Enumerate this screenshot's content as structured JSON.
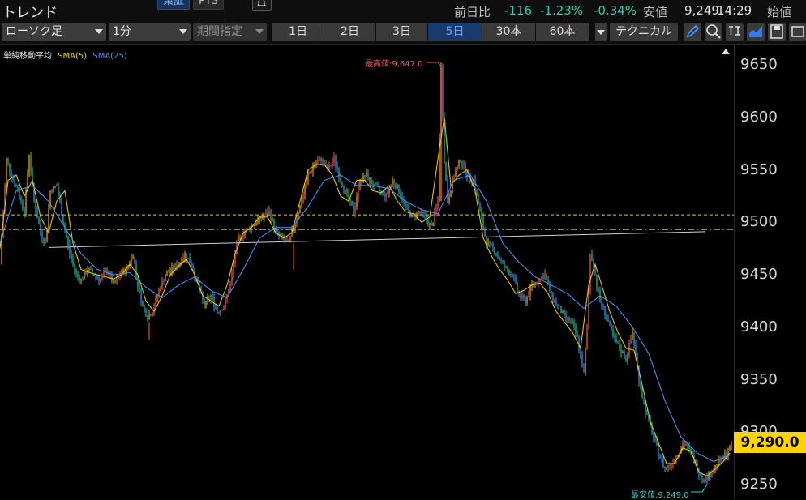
{
  "header": {
    "title": "トレンド",
    "exchange_tabs": [
      "東証",
      "PTS"
    ],
    "prev_day_label": "前日比",
    "change": "-116",
    "change_pct": "-1.23%",
    "change_pct2": "-0.34%",
    "low_label": "安値",
    "low_value": "9,249",
    "time": "14:29",
    "open_label": "始値"
  },
  "toolbar": {
    "chart_type": "ローソク足",
    "interval": "1分",
    "period_placeholder": "期間指定",
    "period_tabs": [
      "1日",
      "2日",
      "3日",
      "5日",
      "30本",
      "60本"
    ],
    "active_period": "5日",
    "technical_label": "テクニカル",
    "icons": [
      "draw-pencil-icon",
      "zoom-icon",
      "output-icon",
      "area-chart-icon",
      "save-icon",
      "window-icon"
    ]
  },
  "legend": {
    "name": "単純移動平均",
    "sma5": "SMA(5)",
    "sma25": "SMA(25)",
    "sma5_color": "#f0d000",
    "sma25_color": "#4f8fff"
  },
  "chart_data": {
    "type": "line",
    "title": "",
    "ylim": [
      9230,
      9680
    ],
    "yticks": [
      9250,
      9300,
      9350,
      9400,
      9450,
      9500,
      9550,
      9600,
      9650
    ],
    "current_price": "9,290.0",
    "high_label": "最高値:9,647.0",
    "low_label": "最安値:9,249.0",
    "reference_lines": [
      {
        "name": "yellow-dashed",
        "value": 9507,
        "color": "#e8d000"
      },
      {
        "name": "cyan-dashdot",
        "value": 9493,
        "color": "#20c8c8"
      }
    ],
    "trend_line": {
      "x": [
        60,
        870
      ],
      "y": [
        9476,
        9491
      ],
      "color": "#d0d0d0"
    },
    "series": [
      {
        "price_path": true,
        "x": [
          0,
          8,
          14,
          22,
          30,
          36,
          42,
          50,
          56,
          62,
          70,
          78,
          86,
          94,
          100,
          108,
          116,
          124,
          132,
          140,
          148,
          156,
          164,
          170,
          176,
          182,
          188,
          196,
          204,
          212,
          220,
          228,
          236,
          244,
          252,
          260,
          268,
          276,
          284,
          292,
          300,
          308,
          316,
          324,
          332,
          340,
          348,
          356,
          364,
          372,
          380,
          388,
          396,
          404,
          412,
          420,
          428,
          436,
          444,
          452,
          460,
          468,
          476,
          484,
          492,
          500,
          508,
          516,
          524,
          532,
          540,
          544,
          548,
          552,
          560,
          568,
          576,
          584,
          592,
          600,
          608,
          616,
          624,
          632,
          640,
          648,
          656,
          664,
          672,
          680,
          688,
          696,
          704,
          712,
          720,
          724,
          728,
          732,
          736,
          740,
          748,
          756,
          764,
          772,
          780,
          788,
          796,
          804,
          812,
          820,
          828,
          836,
          844,
          852,
          860,
          868,
          876,
          884,
          892,
          900
        ],
        "y": [
          9460,
          9560,
          9545,
          9530,
          9510,
          9565,
          9520,
          9490,
          9480,
          9530,
          9535,
          9500,
          9470,
          9450,
          9445,
          9455,
          9450,
          9445,
          9455,
          9440,
          9450,
          9455,
          9470,
          9440,
          9420,
          9410,
          9415,
          9435,
          9450,
          9455,
          9460,
          9470,
          9460,
          9440,
          9420,
          9430,
          9415,
          9420,
          9440,
          9480,
          9490,
          9495,
          9500,
          9505,
          9510,
          9490,
          9485,
          9480,
          9500,
          9520,
          9545,
          9555,
          9560,
          9550,
          9560,
          9540,
          9525,
          9510,
          9540,
          9545,
          9535,
          9530,
          9525,
          9540,
          9530,
          9515,
          9505,
          9510,
          9505,
          9495,
          9520,
          9647,
          9560,
          9520,
          9545,
          9560,
          9545,
          9540,
          9510,
          9480,
          9475,
          9465,
          9455,
          9450,
          9430,
          9425,
          9440,
          9445,
          9450,
          9430,
          9420,
          9410,
          9405,
          9390,
          9355,
          9400,
          9470,
          9460,
          9440,
          9425,
          9410,
          9390,
          9380,
          9370,
          9395,
          9350,
          9320,
          9300,
          9280,
          9265,
          9270,
          9280,
          9290,
          9280,
          9265,
          9255,
          9260,
          9270,
          9275,
          9285
        ]
      },
      {
        "name": "SMA(5)",
        "x": [
          0,
          10,
          20,
          30,
          40,
          50,
          60,
          70,
          80,
          90,
          100,
          110,
          120,
          130,
          140,
          150,
          160,
          170,
          180,
          190,
          200,
          210,
          220,
          230,
          240,
          250,
          260,
          270,
          280,
          290,
          300,
          310,
          320,
          330,
          340,
          350,
          360,
          370,
          380,
          390,
          400,
          410,
          420,
          430,
          440,
          450,
          460,
          470,
          480,
          490,
          500,
          510,
          520,
          530,
          540,
          548,
          556,
          566,
          576,
          586,
          596,
          606,
          616,
          626,
          636,
          646,
          656,
          666,
          676,
          686,
          696,
          706,
          716,
          726,
          734,
          742,
          752,
          762,
          772,
          782,
          792,
          802,
          812,
          822,
          832,
          842,
          852,
          862,
          872,
          882,
          892,
          900
        ],
        "y": [
          9475,
          9540,
          9545,
          9525,
          9540,
          9505,
          9490,
          9520,
          9530,
          9480,
          9455,
          9452,
          9450,
          9448,
          9446,
          9450,
          9460,
          9450,
          9425,
          9415,
          9430,
          9450,
          9458,
          9465,
          9450,
          9430,
          9425,
          9420,
          9440,
          9470,
          9490,
          9495,
          9505,
          9505,
          9490,
          9485,
          9490,
          9520,
          9550,
          9555,
          9555,
          9545,
          9525,
          9520,
          9540,
          9540,
          9530,
          9528,
          9535,
          9520,
          9510,
          9508,
          9500,
          9505,
          9560,
          9600,
          9535,
          9545,
          9550,
          9530,
          9485,
          9468,
          9455,
          9445,
          9432,
          9435,
          9440,
          9442,
          9432,
          9415,
          9405,
          9395,
          9380,
          9440,
          9460,
          9440,
          9415,
          9395,
          9380,
          9378,
          9345,
          9310,
          9290,
          9270,
          9270,
          9285,
          9282,
          9262,
          9258,
          9265,
          9272,
          9280
        ]
      },
      {
        "name": "SMA(25)",
        "x": [
          0,
          20,
          40,
          60,
          80,
          100,
          120,
          140,
          160,
          180,
          200,
          220,
          240,
          260,
          280,
          300,
          320,
          340,
          360,
          380,
          400,
          420,
          440,
          460,
          480,
          500,
          520,
          540,
          560,
          580,
          600,
          620,
          640,
          660,
          680,
          700,
          720,
          740,
          760,
          780,
          800,
          820,
          840,
          860,
          880,
          900
        ],
        "y": [
          9480,
          9530,
          9535,
          9520,
          9495,
          9470,
          9455,
          9450,
          9452,
          9438,
          9428,
          9440,
          9448,
          9435,
          9428,
          9455,
          9485,
          9495,
          9495,
          9515,
          9540,
          9545,
          9535,
          9535,
          9532,
          9520,
          9512,
          9508,
          9540,
          9545,
          9520,
          9480,
          9462,
          9448,
          9440,
          9432,
          9418,
          9430,
          9420,
          9400,
          9375,
          9330,
          9295,
          9280,
          9272,
          9278
        ]
      }
    ]
  }
}
